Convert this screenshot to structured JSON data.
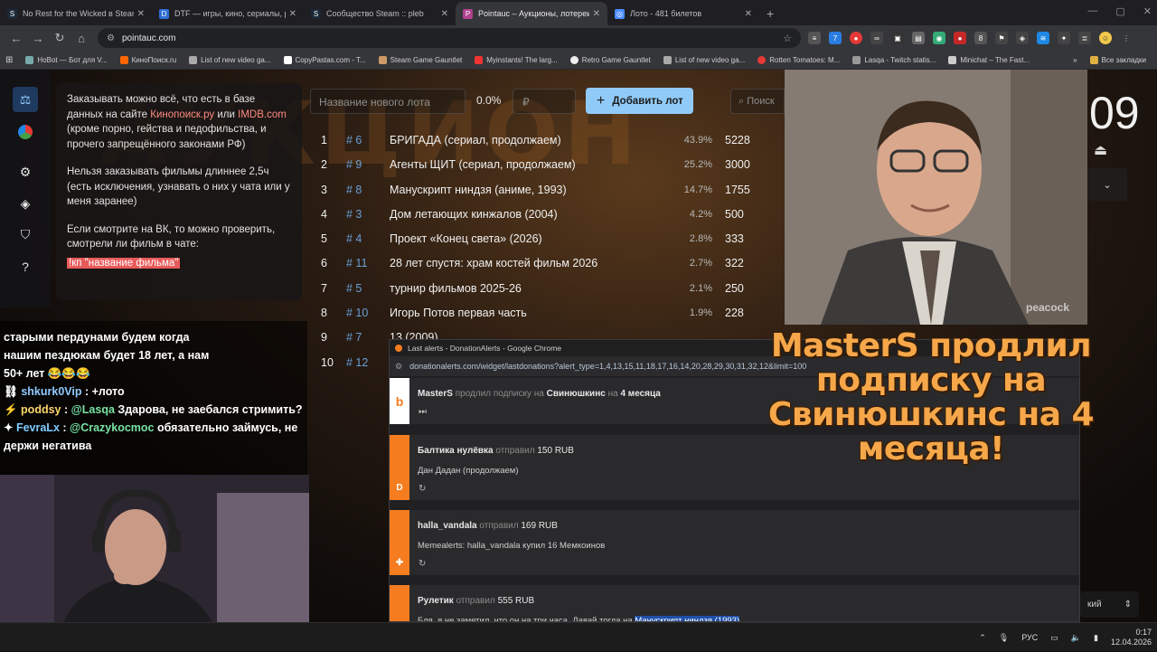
{
  "browser": {
    "tabs": [
      {
        "title": "No Rest for the Wicked в Steam",
        "active": false
      },
      {
        "title": "DTF — игры, кино, сериалы, р",
        "active": false
      },
      {
        "title": "Сообщество Steam :: pleb",
        "active": false
      },
      {
        "title": "Pointauc – Аукционы, лотереи",
        "active": true
      },
      {
        "title": "Лото - 481 билетов",
        "active": false
      }
    ],
    "url": "pointauc.com",
    "bookmarks": [
      "HoBot — Бот для V...",
      "КиноПоиск.ru",
      "List of new video ga...",
      "CopyPastas.com - T...",
      "Steam Game Gauntlet",
      "Myinstants! The larg...",
      "Retro Game Gauntlet",
      "List of new video ga...",
      "Rotten Tomatoes: M...",
      "Lasqa - Twitch statis...",
      "Minichat – The Fast..."
    ],
    "bookmarks_more": "»",
    "all_bookmarks": "Все закладки"
  },
  "rules": {
    "p1_a": "Заказывать можно всё, что есть в базе данных на сайте ",
    "link1": "Кинопоиск.ру",
    "p1_or": " или ",
    "link2": "IMDB.com",
    "p1_b": " (кроме порно, гейства и педофильства, и прочего запрещённого законами РФ)",
    "p2": "Нельзя заказывать фильмы длиннее 2,5ч (есть исключения, узнавать о них у чата или у меня заранее)",
    "p3": "Если смотрите на ВК, то можно проверить, смотрели ли фильм в чате:",
    "cmd": "!кп \"название фильма\""
  },
  "auction": {
    "watermark": "АУКЦИОН",
    "lot_placeholder": "Название нового лота",
    "percent": "0.0%",
    "amount_placeholder": "₽",
    "add_label": "Добавить лот",
    "search_placeholder": "Поиск",
    "timer": "09",
    "lots": [
      {
        "n": "1",
        "id": "# 6",
        "name": "БРИГАДА (сериал, продолжаем)",
        "pct": "43.9%",
        "amount": "5228"
      },
      {
        "n": "2",
        "id": "# 9",
        "name": "Агенты ЩИТ (сериал, продолжаем)",
        "pct": "25.2%",
        "amount": "3000"
      },
      {
        "n": "3",
        "id": "# 8",
        "name": "Манускрипт ниндзя (аниме, 1993)",
        "pct": "14.7%",
        "amount": "1755"
      },
      {
        "n": "4",
        "id": "# 3",
        "name": "Дом летающих кинжалов (2004)",
        "pct": "4.2%",
        "amount": "500"
      },
      {
        "n": "5",
        "id": "# 4",
        "name": "Проект «Конец света» (2026)",
        "pct": "2.8%",
        "amount": "333"
      },
      {
        "n": "6",
        "id": "# 11",
        "name": "28 лет спустя: храм костей фильм 2026",
        "pct": "2.7%",
        "amount": "322"
      },
      {
        "n": "7",
        "id": "# 5",
        "name": "турнир фильмов 2025-26",
        "pct": "2.1%",
        "amount": "250"
      },
      {
        "n": "8",
        "id": "# 10",
        "name": "Игорь Потов первая часть",
        "pct": "1.9%",
        "amount": "228"
      },
      {
        "n": "9",
        "id": "# 7",
        "name": "13 (2009)",
        "pct": "",
        "amount": ""
      },
      {
        "n": "10",
        "id": "# 12",
        "name": "",
        "pct": "",
        "amount": ""
      }
    ]
  },
  "webcam_overlay": {
    "watermark": "peacock"
  },
  "sub_banner": {
    "line1": "MasterS продлил подписку на",
    "line2": "Свинюшкинс на 4 месяца!"
  },
  "chat": {
    "lines": [
      {
        "user": "",
        "text": "старыми пердунами будем когда"
      },
      {
        "user": "",
        "text": "нашим пездюкам будет 18 лет, а нам"
      },
      {
        "user": "",
        "text": "50+ лет 😂😂😂"
      },
      {
        "user": "shkurk0Vip",
        "sep": " : ",
        "text": "+лото"
      },
      {
        "user": "poddsy",
        "sep": " : ",
        "mention": "@Lasqa",
        "text": " Здарова, не заебался стримить?"
      },
      {
        "user": "FevraLx",
        "sep": " : ",
        "mention": "@Crazykocmoc",
        "text": " обязательно займусь, не держи негатива"
      }
    ]
  },
  "donation_alerts": {
    "window_title": "Last alerts - DonationAlerts - Google Chrome",
    "url": "donationalerts.com/widget/lastdonations?alert_type=1,4,13,15,11,18,17,16,14,20,28,29,30,31,32,12&limit=100",
    "alerts": [
      {
        "name": "MasterS",
        "verb": "продлил подписку на",
        "target": "Свинюшкинс",
        "suffix": "на",
        "extra": "4 месяца",
        "message": "",
        "color": "#ffffff",
        "icon": "b"
      },
      {
        "name": "Балтика нулёвка",
        "verb": "отправил",
        "target": "",
        "suffix": "",
        "extra": "150 RUB",
        "message": "Дан Дадан (продолжаем)",
        "color": "#f57c1f",
        "icon": "D"
      },
      {
        "name": "halla_vandala",
        "verb": "отправил",
        "target": "",
        "suffix": "",
        "extra": "169 RUB",
        "message": "Memealerts: halla_vandala купил 16 Мемкоинов",
        "color": "#f57c1f",
        "icon": "✚"
      },
      {
        "name": "Рулетик",
        "verb": "отправил",
        "target": "",
        "suffix": "",
        "extra": "555 RUB",
        "message": "Бля, я не заметил, что он на три часа. Давай тогда на",
        "highlight": "Манускрипт ниндзя (1993)",
        "color": "#f57c1f",
        "icon": "D"
      }
    ],
    "select_partial": "кий"
  },
  "taskbar": {
    "lang": "РУС",
    "time": "0:17",
    "date": "12.04.2026"
  }
}
